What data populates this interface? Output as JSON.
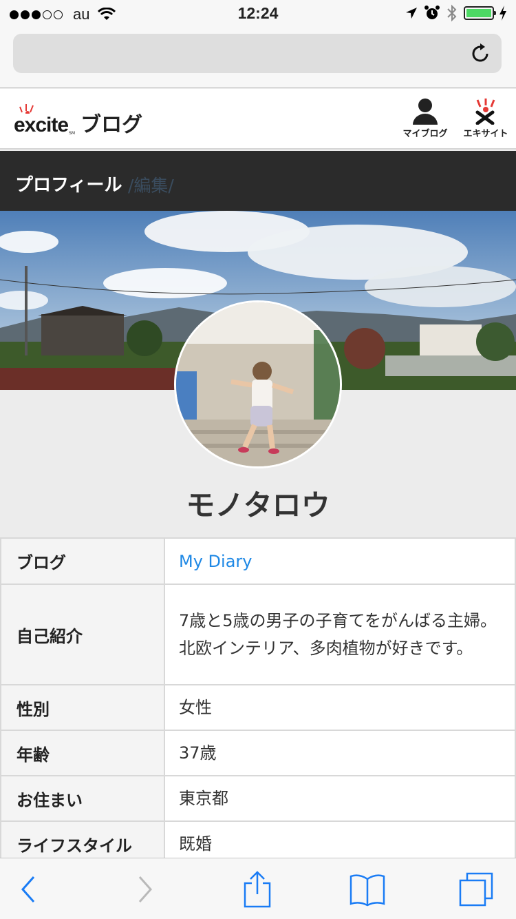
{
  "status_bar": {
    "carrier": "au",
    "time": "12:24"
  },
  "header": {
    "logo_text": "excite",
    "logo_sm": "SM",
    "blog_label": "ブログ",
    "my_blog_label": "マイブログ",
    "excite_label": "エキサイト"
  },
  "title_bar": {
    "title": "プロフィール",
    "edit": "/編集/"
  },
  "profile": {
    "name": "モノタロウ",
    "rows": [
      {
        "key": "ブログ",
        "value": "My Diary"
      },
      {
        "key": "自己紹介",
        "value": "7歳と5歳の男子の子育てをがんばる主婦。北欧インテリア、多肉植物が好きです。"
      },
      {
        "key": "性別",
        "value": "女性"
      },
      {
        "key": "年齢",
        "value": "37歳"
      },
      {
        "key": "お住まい",
        "value": "東京都"
      },
      {
        "key": "ライフスタイル",
        "value": "既婚"
      }
    ]
  },
  "colors": {
    "link": "#1e88e5",
    "ios_blue": "#1a7cf5",
    "battery": "#4cd964",
    "dark_bar": "#2b2b2b",
    "excite_red": "#e53935"
  },
  "icons": {
    "back": "chevron-left-icon",
    "forward": "chevron-right-icon",
    "share": "share-icon",
    "bookmarks": "book-icon",
    "tabs": "tabs-icon",
    "reload": "reload-icon",
    "my_blog": "person-icon",
    "excite": "excite-mascot-icon"
  }
}
